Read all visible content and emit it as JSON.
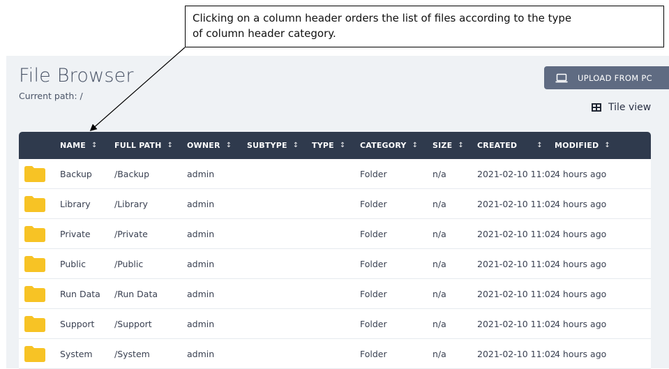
{
  "callout": {
    "line1": "Clicking on a column header orders the list of files according to the type",
    "line2": "of column header category."
  },
  "header": {
    "title": "File Browser",
    "current_path": "Current path: /",
    "upload_label": "UPLOAD FROM PC",
    "upload_icon": "laptop-icon",
    "tile_view_label": "Tile view",
    "tile_view_icon": "grid-icon"
  },
  "table": {
    "columns": [
      {
        "label": "NAME",
        "sort": "↕"
      },
      {
        "label": "FULL PATH",
        "sort": "↕"
      },
      {
        "label": "OWNER",
        "sort": "↕"
      },
      {
        "label": "SUBTYPE",
        "sort": "↕"
      },
      {
        "label": "TYPE",
        "sort": "↕"
      },
      {
        "label": "CATEGORY",
        "sort": "↕"
      },
      {
        "label": "SIZE",
        "sort": "↕"
      },
      {
        "label": "CREATED",
        "sort": "↕"
      },
      {
        "label": "MODIFIED",
        "sort": "↕"
      }
    ],
    "rows": [
      {
        "icon": "folder-icon",
        "name": "Backup",
        "path": "/Backup",
        "owner": "admin",
        "subtype": "",
        "type": "",
        "category": "Folder",
        "size": "n/a",
        "created": "2021-02-10 11:02",
        "modified": "4 hours ago"
      },
      {
        "icon": "folder-icon",
        "name": "Library",
        "path": "/Library",
        "owner": "admin",
        "subtype": "",
        "type": "",
        "category": "Folder",
        "size": "n/a",
        "created": "2021-02-10 11:02",
        "modified": "4 hours ago"
      },
      {
        "icon": "folder-icon",
        "name": "Private",
        "path": "/Private",
        "owner": "admin",
        "subtype": "",
        "type": "",
        "category": "Folder",
        "size": "n/a",
        "created": "2021-02-10 11:02",
        "modified": "4 hours ago"
      },
      {
        "icon": "folder-icon",
        "name": "Public",
        "path": "/Public",
        "owner": "admin",
        "subtype": "",
        "type": "",
        "category": "Folder",
        "size": "n/a",
        "created": "2021-02-10 11:02",
        "modified": "4 hours ago"
      },
      {
        "icon": "folder-icon",
        "name": "Run Data",
        "path": "/Run Data",
        "owner": "admin",
        "subtype": "",
        "type": "",
        "category": "Folder",
        "size": "n/a",
        "created": "2021-02-10 11:02",
        "modified": "4 hours ago"
      },
      {
        "icon": "folder-icon",
        "name": "Support",
        "path": "/Support",
        "owner": "admin",
        "subtype": "",
        "type": "",
        "category": "Folder",
        "size": "n/a",
        "created": "2021-02-10 11:02",
        "modified": "4 hours ago"
      },
      {
        "icon": "folder-icon",
        "name": "System",
        "path": "/System",
        "owner": "admin",
        "subtype": "",
        "type": "",
        "category": "Folder",
        "size": "n/a",
        "created": "2021-02-10 11:02",
        "modified": "4 hours ago"
      }
    ]
  },
  "colors": {
    "header_bg": "#2f3a4d",
    "panel_bg": "#eff2f5",
    "button_bg": "#5f6b82",
    "folder": "#f7c325"
  }
}
